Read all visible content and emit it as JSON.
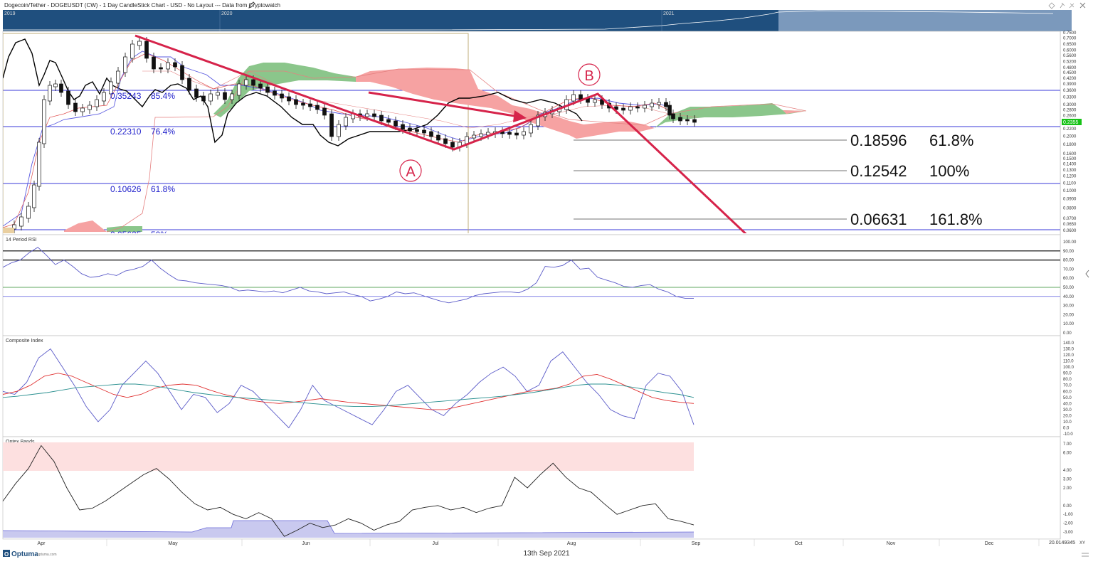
{
  "header": {
    "title": "Dogecoin/Tether - DOGEUSDT (CW) - 1 Day CandleStick Chart - USD - No Layout --- Data from Cryptowatch",
    "edit_icon": "pencil-icon",
    "toolbar_icons": [
      "diamond-icon",
      "pin-icon",
      "tools-icon",
      "close-icon"
    ]
  },
  "overview": {
    "year_labels": [
      "2019",
      "2020",
      "2021"
    ]
  },
  "chart_data": [
    {
      "type": "candlestick",
      "title": "Dogecoin/Tether - DOGEUSDT (CW) - 1 Day CandleStick Chart",
      "price_axis_ticks": [
        "0.7500",
        "0.7000",
        "0.6500",
        "0.6000",
        "0.5600",
        "0.5200",
        "0.4800",
        "0.4500",
        "0.4200",
        "0.3900",
        "0.3600",
        "0.3300",
        "0.3000",
        "0.2800",
        "0.2600",
        "0.2400",
        "0.2200",
        "0.2000",
        "0.1800",
        "0.1600",
        "0.1500",
        "0.1400",
        "0.1300",
        "0.1200",
        "0.1100",
        "0.1000",
        "0.0900",
        "0.0800",
        "0.0700",
        "0.0650",
        "0.0600"
      ],
      "last_price": "0.2355",
      "retracement_labels": [
        {
          "value": "0.35243",
          "pct": "85.4%"
        },
        {
          "value": "0.22310",
          "pct": "76.4%"
        },
        {
          "value": "0.10626",
          "pct": "61.8%"
        },
        {
          "value": "0.05625",
          "pct": "50%"
        }
      ],
      "extension_labels": [
        {
          "value": "0.18596",
          "pct": "61.8%"
        },
        {
          "value": "0.12542",
          "pct": "100%"
        },
        {
          "value": "0.06631",
          "pct": "161.8%"
        }
      ],
      "wave_labels": [
        "A",
        "B"
      ]
    },
    {
      "type": "line",
      "title": "14 Period RSI",
      "axis_ticks": [
        "100.00",
        "90.00",
        "80.00",
        "70.00",
        "60.00",
        "50.00",
        "40.00",
        "30.00",
        "20.00",
        "10.00",
        "0.00"
      ],
      "levels": [
        90,
        80,
        50,
        40
      ],
      "series": [
        {
          "values": [
            72,
            77,
            80,
            88,
            94,
            85,
            75,
            80,
            73,
            65,
            61,
            62,
            65,
            63,
            68,
            70,
            73,
            80,
            71,
            64,
            58,
            57,
            55,
            54,
            53,
            52,
            50,
            46,
            47,
            46,
            45,
            46,
            44,
            47,
            50,
            46,
            45,
            43,
            44,
            45,
            42,
            40,
            35,
            37,
            40,
            45,
            43,
            44,
            41,
            38,
            35,
            33,
            35,
            37,
            41,
            43,
            44,
            45,
            45,
            44,
            48,
            55,
            73,
            72,
            74,
            80,
            70,
            71,
            61,
            58,
            55,
            51,
            50,
            52,
            53,
            48,
            45,
            40,
            38,
            38
          ]
        }
      ]
    },
    {
      "type": "line",
      "title": "Composite Index",
      "axis_ticks": [
        "140.0",
        "130.0",
        "120.0",
        "110.0",
        "100.0",
        "90.0",
        "80.0",
        "70.0",
        "60.0",
        "50.0",
        "40.0",
        "30.0",
        "20.0",
        "10.0",
        "0.0",
        "-10.0"
      ],
      "series": [
        {
          "color": "#5a5ac8",
          "values": [
            60,
            55,
            75,
            115,
            130,
            100,
            70,
            35,
            10,
            30,
            70,
            90,
            110,
            90,
            60,
            30,
            55,
            50,
            25,
            40,
            70,
            60,
            40,
            20,
            0,
            30,
            70,
            45,
            35,
            25,
            15,
            5,
            30,
            60,
            70,
            50,
            30,
            20,
            40,
            55,
            75,
            90,
            100,
            85,
            60,
            70,
            110,
            125,
            100,
            75,
            55,
            30,
            20,
            15,
            70,
            90,
            85,
            60,
            5
          ]
        },
        {
          "color": "#e03030",
          "values": [
            55,
            60,
            70,
            85,
            90,
            85,
            75,
            65,
            55,
            50,
            55,
            65,
            70,
            72,
            70,
            62,
            55,
            50,
            45,
            42,
            40,
            42,
            45,
            48,
            45,
            42,
            40,
            38,
            36,
            34,
            32,
            30,
            30,
            35,
            40,
            45,
            50,
            55,
            60,
            62,
            65,
            72,
            85,
            88,
            80,
            70,
            60,
            50,
            45,
            42,
            40
          ]
        },
        {
          "color": "#2a9090",
          "values": [
            50,
            52,
            55,
            58,
            62,
            66,
            68,
            70,
            72,
            72,
            70,
            66,
            62,
            58,
            55,
            52,
            50,
            48,
            46,
            44,
            42,
            40,
            38,
            36,
            35,
            35,
            36,
            38,
            40,
            42,
            44,
            46,
            48,
            50,
            52,
            55,
            58,
            62,
            66,
            70,
            72,
            72,
            70,
            66,
            62,
            58,
            55,
            50
          ]
        }
      ]
    },
    {
      "type": "line",
      "title": "Optex Bands",
      "axis_ticks": [
        "7.00",
        "6.00",
        "4.00",
        "3.00",
        "2.00",
        "0.00",
        "-1.00",
        "-2.00",
        "-3.00"
      ],
      "series": [
        {
          "values": [
            0.5,
            2.5,
            4.2,
            6.8,
            5.0,
            2.0,
            -0.5,
            -0.3,
            0.5,
            1.5,
            2.5,
            3.5,
            4.2,
            3.0,
            1.5,
            0.2,
            -0.5,
            -0.2,
            -1.0,
            -1.5,
            -0.8,
            -1.5,
            -3.5,
            -2.8,
            -2.0,
            -2.5,
            -2.2,
            -1.5,
            -2.0,
            -2.8,
            -2.2,
            -1.8,
            -0.5,
            -0.2,
            0.0,
            -0.5,
            -0.2,
            -0.8,
            -0.3,
            0.0,
            3.2,
            2.0,
            3.5,
            4.8,
            3.2,
            2.0,
            1.5,
            0.2,
            -1.0,
            -0.5,
            0.0,
            0.2,
            -1.5,
            -1.8,
            -2.2
          ]
        }
      ]
    }
  ],
  "xaxis": {
    "months": [
      "Apr",
      "May",
      "Jun",
      "Jul",
      "Aug",
      "Sep",
      "Oct",
      "Nov",
      "Dec"
    ],
    "date_caption": "13th Sep 2021",
    "cursor_value": "20.0149345",
    "cursor_unit": "XY"
  },
  "footer": {
    "brand": "Optuma",
    "brand_site": "optuma.com"
  },
  "colors": {
    "overview_bg": "#1f4f7e",
    "arrow": "#d6234a",
    "fib_line": "#3a3ad8",
    "cloud_red": "#f6a2a2",
    "cloud_green": "#8bc68b",
    "last_price_bg": "#16c216"
  }
}
